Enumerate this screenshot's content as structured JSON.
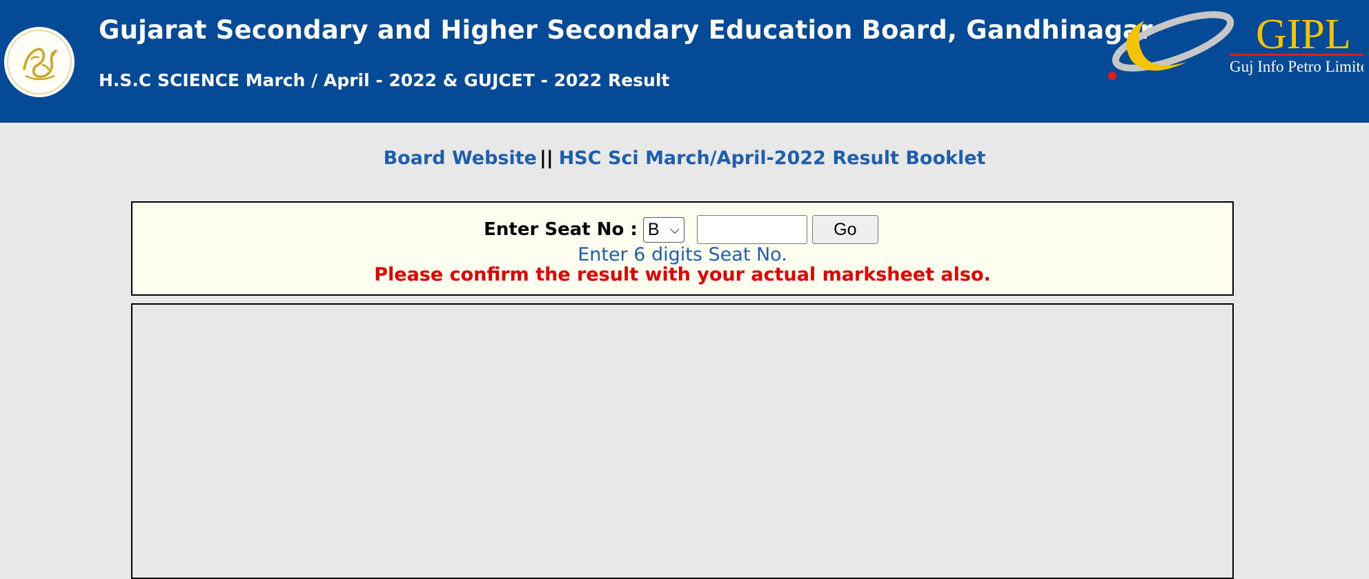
{
  "header": {
    "title": "Gujarat Secondary and Higher Secondary Education Board, Gandhinagar",
    "subtitle": "H.S.C SCIENCE March / April - 2022 & GUJCET - 2022 Result",
    "board_logo_icon": "board-emblem-icon",
    "partner_logo": {
      "name": "GIPL",
      "tagline": "Guj Info Petro Limited",
      "icon": "gipl-crescent-icon"
    },
    "colors": {
      "background": "#054a96",
      "text": "#ffffff"
    }
  },
  "links": {
    "board_website": "Board Website",
    "separator": "||",
    "result_booklet": "HSC Sci March/April-2022 Result Booklet",
    "color": "#1d5fae"
  },
  "seat_form": {
    "label": "Enter Seat No :",
    "prefix_selected": "B",
    "seat_value": "",
    "go_label": "Go",
    "hint": "Enter 6 digits Seat No.",
    "warning": "Please confirm the result with your actual marksheet also.",
    "colors": {
      "panel_bg": "#fffdf0",
      "hint": "#1d5fae",
      "warning": "#e00000"
    }
  },
  "page": {
    "background": "#e8e8e8"
  }
}
